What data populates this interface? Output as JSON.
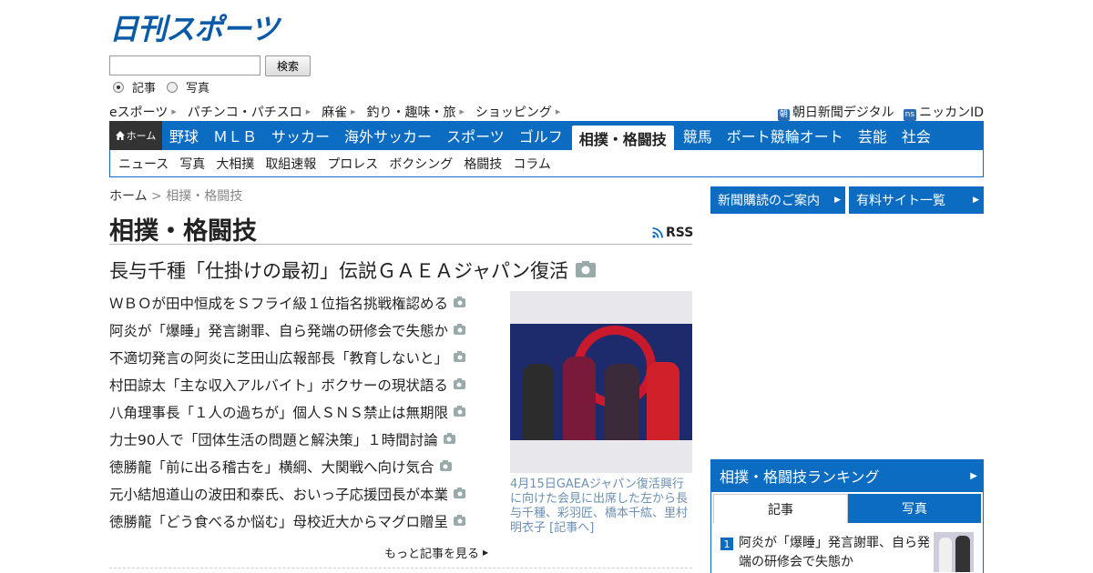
{
  "brand": {
    "logo_text": "日刊スポーツ",
    "accent": "#0b6cc2"
  },
  "search": {
    "button": "検索",
    "placeholder": "",
    "value": "",
    "options": [
      "記事",
      "写真"
    ],
    "selected": "記事"
  },
  "sublinks": {
    "left": [
      "eスポーツ",
      "パチンコ・パチスロ",
      "麻雀",
      "釣り・趣味・旅",
      "ショッピング"
    ],
    "right": [
      {
        "badge": "朝",
        "label": "朝日新聞デジタル"
      },
      {
        "badge": "ns",
        "label": "ニッカンID"
      }
    ]
  },
  "nav": {
    "home": "ホーム",
    "tabs": [
      "野球",
      "ＭＬＢ",
      "サッカー",
      "海外サッカー",
      "スポーツ",
      "ゴルフ",
      "相撲・格闘技",
      "競馬",
      "ボート競輪オート",
      "芸能",
      "社会"
    ],
    "active": "相撲・格闘技",
    "subtabs": [
      "ニュース",
      "写真",
      "大相撲",
      "取組速報",
      "プロレス",
      "ボクシング",
      "格闘技",
      "コラム"
    ]
  },
  "breadcrumb": {
    "home": "ホーム",
    "sep": ">",
    "current": "相撲・格闘技"
  },
  "page_title": "相撲・格闘技",
  "rss": "RSS",
  "headline": "長与千種「仕掛けの最初」伝説ＧＡＥＡジャパン復活",
  "news": [
    "ＷＢＯが田中恒成をＳフライ級１位指名挑戦権認める",
    "阿炎が「爆睡」発言謝罪、自ら発端の研修会で失態か",
    "不適切発言の阿炎に芝田山広報部長「教育しないと」",
    "村田諒太「主な収入アルバイト」ボクサーの現状語る",
    "八角理事長「１人の過ちが」個人ＳＮＳ禁止は無期限",
    "力士90人で「団体生活の問題と解決策」１時間討論",
    "徳勝龍「前に出る稽古を」横綱、大関戦へ向け気合",
    "元小結旭道山の波田和泰氏、おいっ子応援団長が本業",
    "徳勝龍「どう食べるか悩む」母校近大からマグロ贈呈"
  ],
  "more": "もっと記事を見る",
  "photo": {
    "caption": "4月15日GAEAジャパン復活興行に向けた会見に出席した左から長与千種、彩羽匠、橋本千紘、里村明衣子 [記事へ]"
  },
  "right": {
    "buttons": [
      "新聞購読のご案内",
      "有料サイト一覧"
    ],
    "ranking": {
      "title": "相撲・格闘技ランキング",
      "tabs": [
        "記事",
        "写真"
      ],
      "active_tab": "記事",
      "items": [
        {
          "rank": "1",
          "title": "阿炎が「爆睡」発言謝罪、自ら発端の研修会で失態か"
        }
      ]
    }
  }
}
